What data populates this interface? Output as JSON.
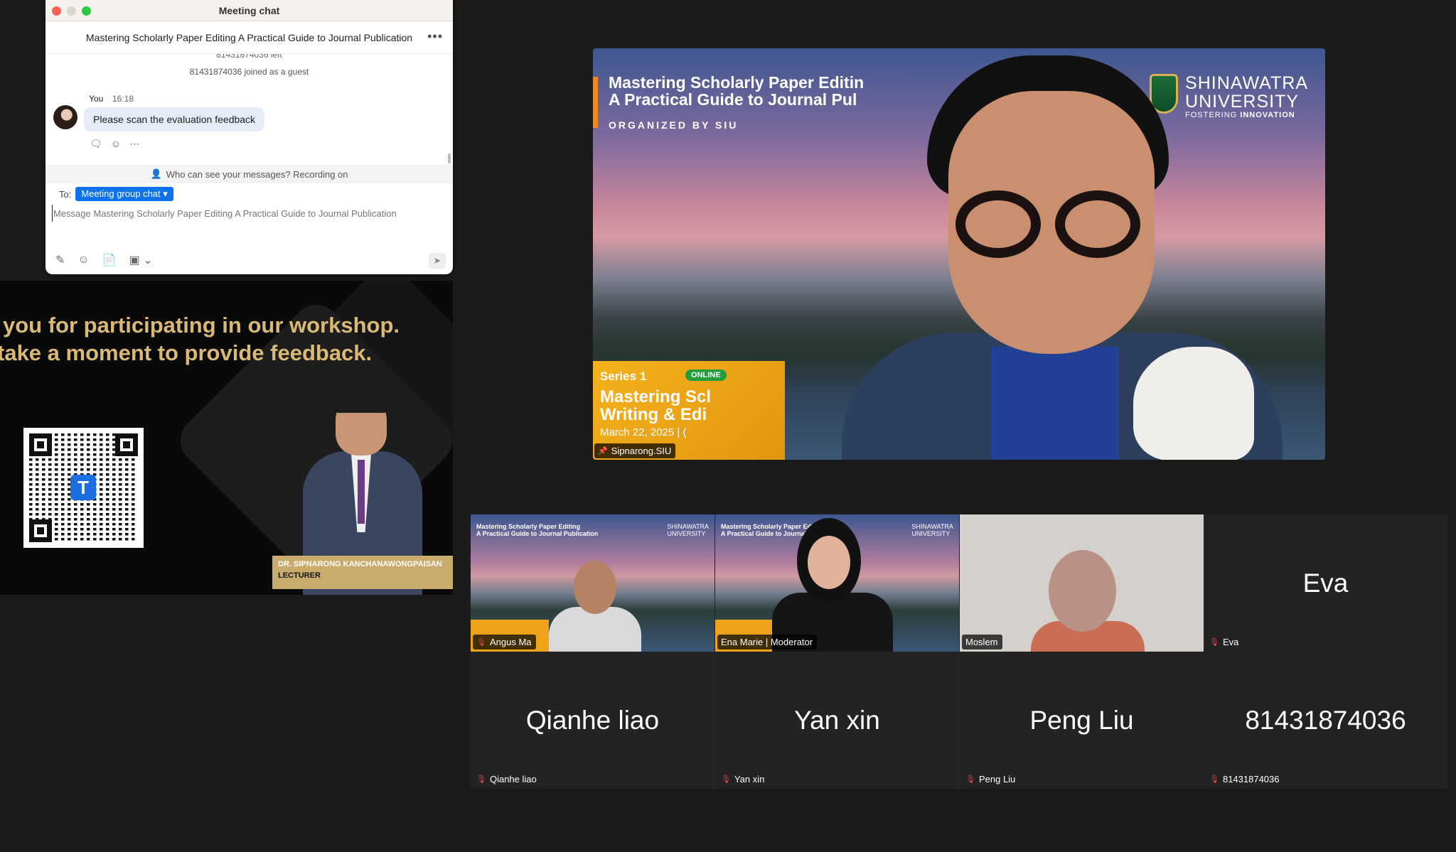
{
  "chat": {
    "window_title": "Meeting chat",
    "meeting_name": "Mastering Scholarly Paper Editing A Practical Guide to Journal Publication",
    "more_label": "•••",
    "system_cut": "81431874036 left",
    "system_joined": "81431874036 joined as a guest",
    "sender": "You",
    "time": "16:18",
    "message": "Please scan the evaluation feedback",
    "recording_note": "Who can see your messages? Recording on",
    "to_label": "To:",
    "recipient": "Meeting group chat",
    "input_placeholder": "Message Mastering Scholarly Paper Editing A Practical Guide to Journal Publication"
  },
  "slide": {
    "line1": "you for participating in our workshop.",
    "line2": "take a moment to provide feedback.",
    "lecturer_name": "DR. SIPNARONG KANCHANAWONGPAISAN",
    "lecturer_role": "LECTURER"
  },
  "speaker": {
    "bg_title_1": "Mastering Scholarly Paper Editin",
    "bg_title_2": "A Practical Guide to Journal Pul",
    "bg_org": "ORGANIZED BY SIU",
    "uni_name_1": "SHINAWATRA",
    "uni_name_2": "UNIVERSITY",
    "uni_tag_1": "FOSTERING",
    "uni_tag_2": "INNOVATION",
    "series": "Series 1",
    "online": "ONLINE",
    "series_text_1": "Mastering Scl",
    "series_text_2": "Writing & Edi",
    "series_date": "March 22, 2025 | (",
    "name": "Sipnarong.SIU"
  },
  "gallery": [
    {
      "name": "Angus Ma",
      "type": "video"
    },
    {
      "name": "Ena Marie | Moderator",
      "type": "video"
    },
    {
      "name": "Moslem",
      "type": "video"
    },
    {
      "name": "Eva",
      "big_name": "Eva",
      "type": "name"
    },
    {
      "name": "Qianhe liao",
      "big_name": "Qianhe liao",
      "type": "name"
    },
    {
      "name": "Yan xin",
      "big_name": "Yan xin",
      "type": "name"
    },
    {
      "name": "Peng Liu",
      "big_name": "Peng Liu",
      "type": "name"
    },
    {
      "name": "81431874036",
      "big_name": "81431874036",
      "type": "name"
    }
  ],
  "mini_slide": {
    "title_1": "Mastering Scholarly Paper Editing",
    "title_2": "A Practical Guide to Journal Publication",
    "logo_1": "SHINAWATRA",
    "logo_2": "UNIVERSITY"
  },
  "colors": {
    "chip_blue": "#0e72ed",
    "gold_text": "#d9b974",
    "mic_off": "#e5484d"
  }
}
